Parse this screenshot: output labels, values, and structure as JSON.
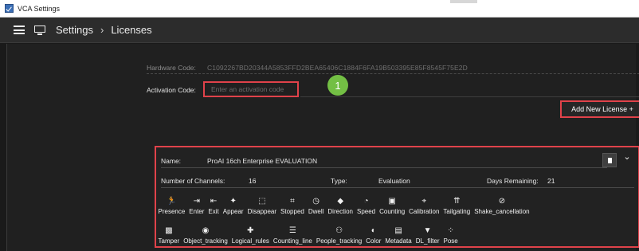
{
  "window": {
    "title": "VCA Settings"
  },
  "breadcrumb": {
    "root": "Settings",
    "separator": "›",
    "current": "Licenses"
  },
  "hardware": {
    "label": "Hardware Code:",
    "value": "C1092267BD20344A5853FFD2BEA65406C1884F6FA19B503395E85F8545F75E2D"
  },
  "activation": {
    "label": "Activation Code:",
    "placeholder": "Enter an activation code"
  },
  "annotation": {
    "badge": "1"
  },
  "add_license": {
    "label": "Add New License +"
  },
  "license": {
    "name_label": "Name:",
    "name_value": "ProAI 16ch Enterprise EVALUATION",
    "channels_label": "Number of Channels:",
    "channels_value": "16",
    "type_label": "Type:",
    "type_value": "Evaluation",
    "days_label": "Days Remaining:",
    "days_value": "21",
    "expand_icon": "chevron-down",
    "features_row1": [
      {
        "label": "Presence",
        "icon": "person-running-icon",
        "glyph": "🏃"
      },
      {
        "label": "Enter",
        "icon": "enter-icon",
        "glyph": "⇥"
      },
      {
        "label": "Exit",
        "icon": "exit-icon",
        "glyph": "⇤"
      },
      {
        "label": "Appear",
        "icon": "magic-wand-icon",
        "glyph": "✦"
      },
      {
        "label": "Disappear",
        "icon": "dashed-square-icon",
        "glyph": "⬚"
      },
      {
        "label": "Stopped",
        "icon": "stopped-icon",
        "glyph": "⌗"
      },
      {
        "label": "Dwell",
        "icon": "clock-icon",
        "glyph": "◷"
      },
      {
        "label": "Direction",
        "icon": "direction-icon",
        "glyph": "◆"
      },
      {
        "label": "Speed",
        "icon": "speedometer-icon",
        "glyph": "◔"
      },
      {
        "label": "Counting",
        "icon": "counter-icon",
        "glyph": "▣"
      },
      {
        "label": "Calibration",
        "icon": "crosshair-icon",
        "glyph": "⌖"
      },
      {
        "label": "Tailgating",
        "icon": "tailgating-icon",
        "glyph": "⇈"
      },
      {
        "label": "Shake_cancellation",
        "icon": "shake-icon",
        "glyph": "⊘"
      }
    ],
    "features_row2": [
      {
        "label": "Tamper",
        "icon": "tamper-icon",
        "glyph": "▩"
      },
      {
        "label": "Object_tracking",
        "icon": "target-icon",
        "glyph": "◉"
      },
      {
        "label": "Logical_rules",
        "icon": "puzzle-icon",
        "glyph": "✚"
      },
      {
        "label": "Counting_line",
        "icon": "list-icon",
        "glyph": "☰"
      },
      {
        "label": "People_tracking",
        "icon": "people-icon",
        "glyph": "⚇"
      },
      {
        "label": "Color",
        "icon": "droplet-icon",
        "glyph": "◐"
      },
      {
        "label": "Metadata",
        "icon": "document-icon",
        "glyph": "▤"
      },
      {
        "label": "DL_filter",
        "icon": "filter-icon",
        "glyph": "▼"
      },
      {
        "label": "Pose",
        "icon": "pose-icon",
        "glyph": "⁘"
      }
    ]
  },
  "colors": {
    "highlight": "#e0424a",
    "badge": "#73bf44",
    "background": "#202020"
  }
}
